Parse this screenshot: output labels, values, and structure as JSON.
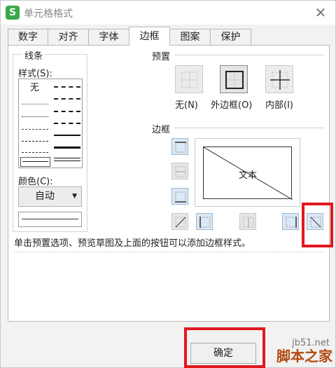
{
  "window": {
    "title": "单元格格式",
    "app_icon_glyph": "S",
    "close_glyph": "✕"
  },
  "tabs": [
    "数字",
    "对齐",
    "字体",
    "边框",
    "图案",
    "保护"
  ],
  "active_tab": "边框",
  "line": {
    "group_label": "线条",
    "style_label": "样式(S):",
    "none_label": "无",
    "color_label": "颜色(C):",
    "color_value": "自动"
  },
  "presets": {
    "section_label": "预置",
    "items": [
      {
        "label": "无(N)",
        "icon": "preset-none-icon"
      },
      {
        "label": "外边框(O)",
        "icon": "preset-outline-icon"
      },
      {
        "label": "内部(I)",
        "icon": "preset-inside-icon"
      }
    ]
  },
  "border": {
    "section_label": "边框",
    "preview_text": "文本"
  },
  "hint": "单击预置选项、预览草图及上面的按钮可以添加边框样式。",
  "ok_label": "确定",
  "watermark": {
    "url": "jb51.net",
    "name": "脚本之家"
  },
  "colors": {
    "accent_blue": "#dbe8f5",
    "highlight_red": "#e0191f"
  }
}
